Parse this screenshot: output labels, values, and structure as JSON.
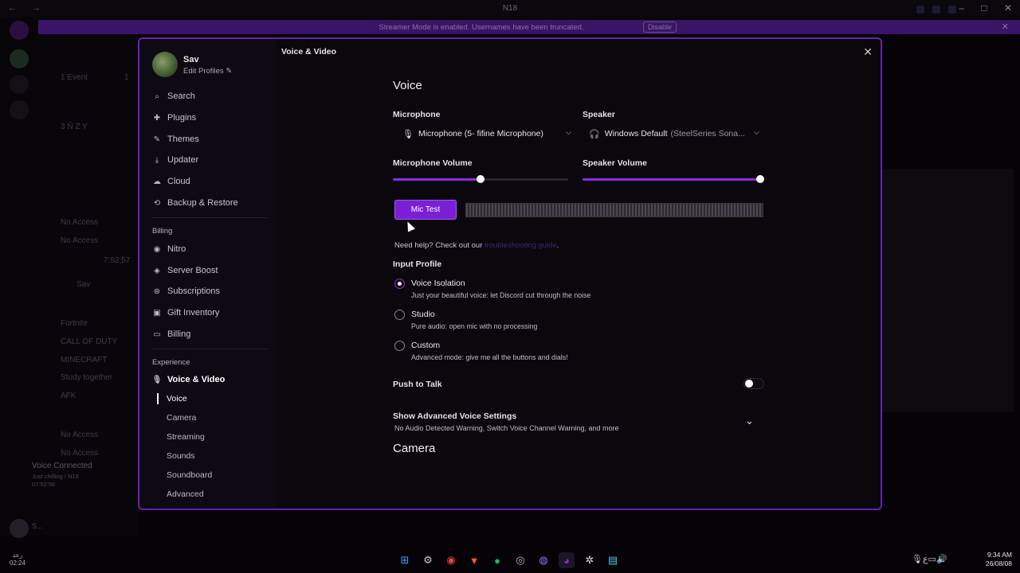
{
  "window": {
    "title": "N18"
  },
  "banner": {
    "text": "Streamer Mode is enabled. Usernames have been truncated.",
    "button": "Disable"
  },
  "background": {
    "channels": [
      "1 Event",
      "3 Ñ Z Y",
      "No Access",
      "No Access",
      "Fortnite",
      "CALL OF DUTY",
      "MINECRAFT",
      "Study together",
      "AFK",
      "No Access",
      "No Access"
    ],
    "event_count": "1",
    "voice_user": "Sav",
    "voice_connected": "Voice Connected",
    "voice_status": "Just chilling / N18",
    "voice_time": "07:52:56",
    "timestamp": "7:52:57",
    "user": "S..."
  },
  "profile": {
    "name": "Sav",
    "edit": "Edit Profiles"
  },
  "nav": {
    "search": "Search",
    "items": [
      {
        "label": "Plugins",
        "icon": "puzzle-icon"
      },
      {
        "label": "Themes",
        "icon": "brush-icon"
      },
      {
        "label": "Updater",
        "icon": "download-icon"
      },
      {
        "label": "Cloud",
        "icon": "cloud-icon"
      },
      {
        "label": "Backup & Restore",
        "icon": "backup-icon"
      }
    ],
    "billing_header": "Billing",
    "billing": [
      {
        "label": "Nitro",
        "icon": "nitro-icon"
      },
      {
        "label": "Server Boost",
        "icon": "boost-icon"
      },
      {
        "label": "Subscriptions",
        "icon": "subscriptions-icon"
      },
      {
        "label": "Gift Inventory",
        "icon": "gift-icon"
      },
      {
        "label": "Billing",
        "icon": "card-icon"
      }
    ],
    "experience_header": "Experience",
    "active": "Voice & Video",
    "sub": [
      "Voice",
      "Camera",
      "Streaming",
      "Sounds",
      "Soundboard",
      "Advanced"
    ]
  },
  "content": {
    "breadcrumb": "Voice & Video",
    "voice_title": "Voice",
    "microphone_label": "Microphone",
    "microphone_value": "Microphone (5- fifine Microphone)",
    "speaker_label": "Speaker",
    "speaker_value": "Windows Default",
    "speaker_detail": "(SteelSeries Sona...",
    "mic_volume_label": "Microphone Volume",
    "mic_volume": 0.5,
    "speaker_volume_label": "Speaker Volume",
    "speaker_volume": 1.0,
    "mic_test": "Mic Test",
    "help_text": "Need help? Check out our",
    "help_link": "troubleshooting guide",
    "help_end": ".",
    "input_profile_label": "Input Profile",
    "profiles": [
      {
        "title": "Voice Isolation",
        "desc": "Just your beautiful voice: let Discord cut through the noise",
        "selected": true
      },
      {
        "title": "Studio",
        "desc": "Pure audio: open mic with no processing",
        "selected": false
      },
      {
        "title": "Custom",
        "desc": "Advanced mode: give me all the buttons and dials!",
        "selected": false
      }
    ],
    "push_to_talk": "Push to Talk",
    "push_to_talk_on": false,
    "advanced_title": "Show Advanced Voice Settings",
    "advanced_desc": "No Audio Detected Warning, Switch Voice Channel Warning, and more",
    "camera_title": "Camera"
  },
  "taskbar": {
    "left_top": "رعد",
    "left_time": "02:24",
    "time": "9:34 AM",
    "date": "26/08/08",
    "lang": "ع",
    "discord_badge": "9"
  },
  "colors": {
    "accent": "#8a2be2",
    "banner": "#3a1466",
    "border": "#6a1fb5"
  }
}
